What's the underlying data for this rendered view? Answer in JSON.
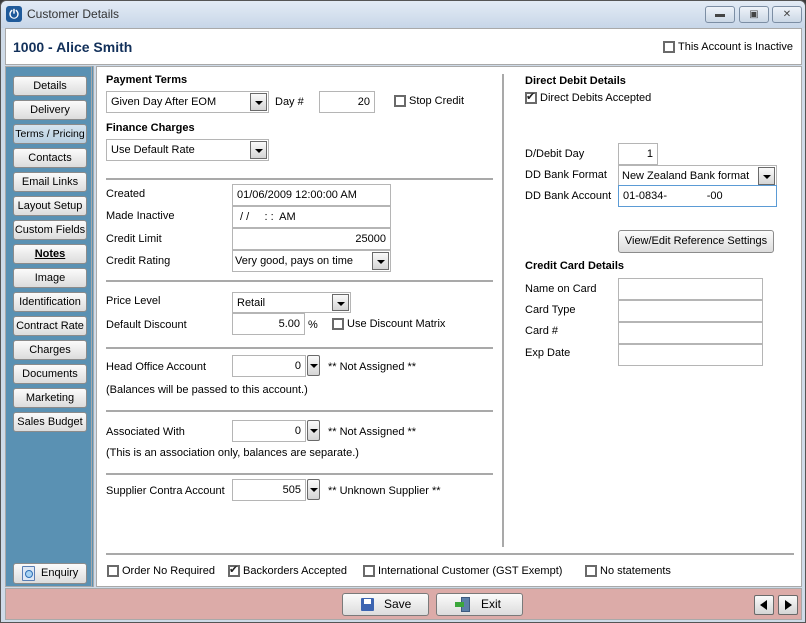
{
  "window": {
    "title": "Customer Details",
    "controls": [
      "minimize",
      "restore",
      "close"
    ]
  },
  "header": {
    "customer_title": "1000 - Alice Smith",
    "inactive_checkbox": {
      "label": "This Account is Inactive",
      "checked": false
    }
  },
  "sidebar": {
    "items": [
      {
        "label": "Details"
      },
      {
        "label": "Delivery"
      },
      {
        "label": "Terms / Pricing",
        "active": true
      },
      {
        "label": "Contacts"
      },
      {
        "label": "Email Links"
      },
      {
        "label": "Layout Setup"
      },
      {
        "label": "Custom Fields"
      },
      {
        "label": "Notes",
        "bold": true
      },
      {
        "label": "Image"
      },
      {
        "label": "Identification"
      },
      {
        "label": "Contract Rate"
      },
      {
        "label": "Charges"
      },
      {
        "label": "Documents"
      },
      {
        "label": "Marketing"
      },
      {
        "label": "Sales Budget"
      }
    ],
    "enquiry_label": "Enquiry"
  },
  "payment_terms": {
    "title": "Payment Terms",
    "terms_value": "Given Day After EOM",
    "day_label": "Day #",
    "day_value": "20",
    "stop_credit": {
      "label": "Stop Credit",
      "checked": false
    }
  },
  "finance_charges": {
    "title": "Finance Charges",
    "value": "Use Default Rate"
  },
  "account_info": {
    "created_label": "Created",
    "created_value": "01/06/2009 12:00:00 AM",
    "made_inactive_label": "Made Inactive",
    "made_inactive_value": " / /     : :  AM",
    "credit_limit_label": "Credit Limit",
    "credit_limit_value": "25000",
    "credit_rating_label": "Credit Rating",
    "credit_rating_value": "Very good, pays on time"
  },
  "pricing": {
    "price_level_label": "Price Level",
    "price_level_value": "Retail",
    "default_discount_label": "Default Discount",
    "default_discount_value": "5.00",
    "percent_sign": "%",
    "discount_matrix": {
      "label": "Use Discount Matrix",
      "checked": false
    }
  },
  "head_office": {
    "label": "Head Office Account",
    "value": "0",
    "name": "** Not Assigned **",
    "note": "(Balances will be passed to this account.)"
  },
  "associated": {
    "label": "Associated With",
    "value": "0",
    "name": "** Not Assigned **",
    "note": "(This is an association only, balances are separate.)"
  },
  "supplier_contra": {
    "label": "Supplier Contra Account",
    "value": "505",
    "name": "** Unknown Supplier **"
  },
  "direct_debit": {
    "title": "Direct Debit Details",
    "accepted": {
      "label": "Direct Debits Accepted",
      "checked": true
    },
    "day_label": "D/Debit Day",
    "day_value": "1",
    "bank_format_label": "DD Bank Format",
    "bank_format_value": "New Zealand Bank format",
    "bank_account_label": "DD Bank Account",
    "bank_account_value": "01-0834-             -00",
    "reference_button": "View/Edit Reference Settings"
  },
  "credit_card": {
    "title": "Credit Card Details",
    "name_label": "Name on Card",
    "name_value": "",
    "type_label": "Card Type",
    "type_value": "",
    "number_label": "Card #",
    "number_value": "",
    "exp_label": "Exp Date",
    "exp_value": ""
  },
  "options": [
    {
      "label": "Order No Required",
      "checked": false
    },
    {
      "label": "Backorders Accepted",
      "checked": true
    },
    {
      "label": "International Customer (GST Exempt)",
      "checked": false
    },
    {
      "label": "No statements",
      "checked": false
    }
  ],
  "footer": {
    "save_label": "Save",
    "exit_label": "Exit"
  }
}
